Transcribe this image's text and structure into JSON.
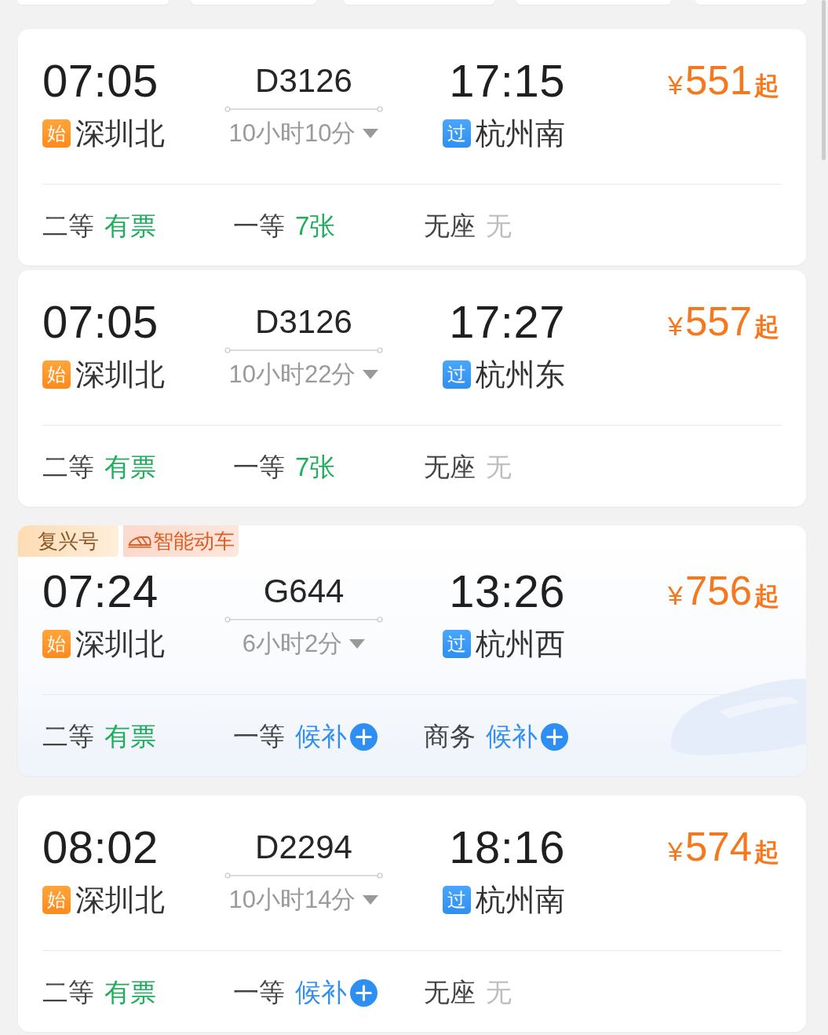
{
  "trains": [
    {
      "departure": {
        "time": "07:05",
        "badge": {
          "text": "始",
          "kind": "start"
        },
        "station": "深圳北"
      },
      "number": "D3126",
      "duration": "10小时10分",
      "arrival": {
        "time": "17:15",
        "badge": {
          "text": "过",
          "kind": "pass"
        },
        "station": "杭州南"
      },
      "price": {
        "currency": "¥",
        "amount": "551",
        "suffix": "起"
      },
      "seats": [
        {
          "class": "二等",
          "status": "有票",
          "kind": "available"
        },
        {
          "class": "一等",
          "status": "7张",
          "kind": "available"
        },
        {
          "class": "无座",
          "status": "无",
          "kind": "none"
        }
      ]
    },
    {
      "departure": {
        "time": "07:05",
        "badge": {
          "text": "始",
          "kind": "start"
        },
        "station": "深圳北"
      },
      "number": "D3126",
      "duration": "10小时22分",
      "arrival": {
        "time": "17:27",
        "badge": {
          "text": "过",
          "kind": "pass"
        },
        "station": "杭州东"
      },
      "price": {
        "currency": "¥",
        "amount": "557",
        "suffix": "起"
      },
      "seats": [
        {
          "class": "二等",
          "status": "有票",
          "kind": "available"
        },
        {
          "class": "一等",
          "status": "7张",
          "kind": "available"
        },
        {
          "class": "无座",
          "status": "无",
          "kind": "none"
        }
      ]
    },
    {
      "tags": [
        {
          "label": "复兴号",
          "kind": "brand"
        },
        {
          "label": "智能动车",
          "kind": "smart"
        }
      ],
      "departure": {
        "time": "07:24",
        "badge": {
          "text": "始",
          "kind": "start"
        },
        "station": "深圳北"
      },
      "number": "G644",
      "duration": "6小时2分",
      "arrival": {
        "time": "13:26",
        "badge": {
          "text": "过",
          "kind": "pass"
        },
        "station": "杭州西"
      },
      "price": {
        "currency": "¥",
        "amount": "756",
        "suffix": "起"
      },
      "seats": [
        {
          "class": "二等",
          "status": "有票",
          "kind": "available"
        },
        {
          "class": "一等",
          "status": "候补",
          "kind": "waitlist"
        },
        {
          "class": "商务",
          "status": "候补",
          "kind": "waitlist"
        }
      ]
    },
    {
      "departure": {
        "time": "08:02",
        "badge": {
          "text": "始",
          "kind": "start"
        },
        "station": "深圳北"
      },
      "number": "D2294",
      "duration": "10小时14分",
      "arrival": {
        "time": "18:16",
        "badge": {
          "text": "过",
          "kind": "pass"
        },
        "station": "杭州南"
      },
      "price": {
        "currency": "¥",
        "amount": "574",
        "suffix": "起"
      },
      "seats": [
        {
          "class": "二等",
          "status": "有票",
          "kind": "available"
        },
        {
          "class": "一等",
          "status": "候补",
          "kind": "waitlist"
        },
        {
          "class": "无座",
          "status": "无",
          "kind": "none"
        }
      ]
    }
  ]
}
